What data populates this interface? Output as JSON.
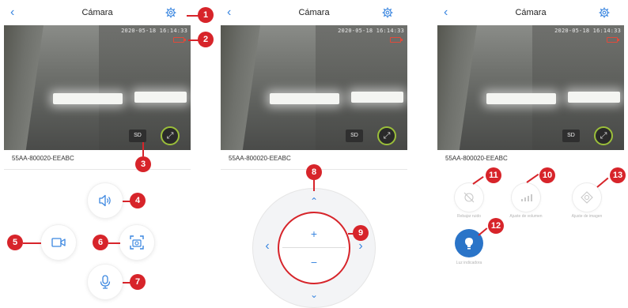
{
  "screen_title": "Cámara",
  "timestamp": "2020-05-18 16:14:33",
  "sd_label": "SD",
  "device_id": "55AA-800020-EEABC",
  "ptz": {
    "plus": "+",
    "minus": "−"
  },
  "panel3": {
    "buttons": [
      {
        "label": "Rebajar ruido"
      },
      {
        "label": "Ajuste de volumen"
      },
      {
        "label": "Ajuste de imagen"
      },
      {
        "label": "Luz indicadora"
      }
    ]
  },
  "callouts": [
    "1",
    "2",
    "3",
    "4",
    "5",
    "6",
    "7",
    "8",
    "9",
    "10",
    "11",
    "12",
    "13"
  ],
  "colors": {
    "accent": "#3a86e0",
    "callout": "#d7242a",
    "selected": "#2a74c8",
    "battery": "#e24a3a"
  }
}
